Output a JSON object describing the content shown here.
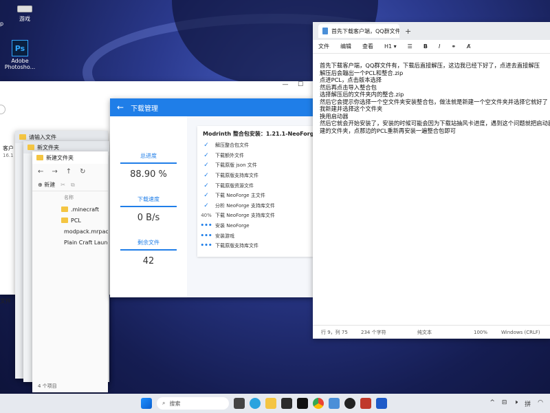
{
  "desktop": {
    "icons": [
      {
        "label": "游戏",
        "icon": "drive-icon"
      },
      {
        "label": "Adobe Photosho...",
        "icon": "photoshop-icon",
        "glyph": "Ps"
      }
    ],
    "edge_fragments": {
      "p": "p",
      "customer": "客户",
      "version": "16.1",
      "file": "文件"
    }
  },
  "explorer_stack": {
    "tab1": "请输入文件",
    "tab2": "新文件夹",
    "tab_active": "新建文件夹",
    "new_button": "新建",
    "column_name": "名称",
    "files": [
      {
        "name": ".minecraft",
        "icon": "folder-icon"
      },
      {
        "name": "PCL",
        "icon": "folder-icon"
      },
      {
        "name": "modpack.mrpack",
        "icon": "modpack-icon"
      },
      {
        "name": "Plain Craft Launcher",
        "icon": "pcl-icon"
      }
    ],
    "status": "4 个项目"
  },
  "download_manager": {
    "title": "下载管理",
    "stats": [
      {
        "label": "总进度",
        "value": "88.90 %"
      },
      {
        "label": "下载速度",
        "value": "0 B/s"
      },
      {
        "label": "剩余文件",
        "value": "42"
      }
    ],
    "card_title": "Modrinth 整合包安装：1.21.1-NeoForge_21.1.2",
    "steps": [
      {
        "mark": "✓",
        "text": "解压整合包文件"
      },
      {
        "mark": "✓",
        "text": "下载额外文件"
      },
      {
        "mark": "✓",
        "text": "下载原版 json 文件"
      },
      {
        "mark": "✓",
        "text": "下载原版支持库文件"
      },
      {
        "mark": "✓",
        "text": "下载原版资源文件"
      },
      {
        "mark": "✓",
        "text": "下载 NeoForge 主文件"
      },
      {
        "mark": "✓",
        "text": "分析 NeoForge 支持库文件"
      },
      {
        "mark": "40%",
        "text": "下载 NeoForge 支持库文件"
      },
      {
        "mark": "•••",
        "text": "安装 NeoForge"
      },
      {
        "mark": "•••",
        "text": "安装游戏"
      },
      {
        "mark": "•••",
        "text": "下载原版支持库文件"
      }
    ]
  },
  "notepad": {
    "tab_title": "首先下载客户端，QQ群文件有，下载",
    "menu": [
      "文件",
      "编辑",
      "查看"
    ],
    "heading_select": "H1",
    "lines": [
      "首先下载客户端，QQ群文件有，下载后直接解压，这边我已经下好了，点进去直接解压",
      "解压后会蹦出一个PCL和整合.zip",
      "点进PCL，点击版本选择",
      "然后再点击导入整合包",
      "选择解压后的文件夹内的整合.zip",
      "然后它会提示你选择一个空文件夹安装整合包，做法就是新建一个空文件夹并选择它就好了",
      "我新建并选择这个文件夹",
      "换用启动器",
      "然后它就会开始安装了，安装的时候可能会因为下载站抽风卡进度，遇到这个问题就把启动器",
      "建的文件夹，点那边的PCL重新再安装一遍整合包即可"
    ],
    "status": {
      "position": "行 9，列 75",
      "chars": "234 个字符",
      "format": "纯文本",
      "zoom": "100%",
      "encoding": "Windows (CRLF)"
    }
  },
  "taskbar": {
    "search_placeholder": "搜索",
    "tray_lang": "拼"
  }
}
